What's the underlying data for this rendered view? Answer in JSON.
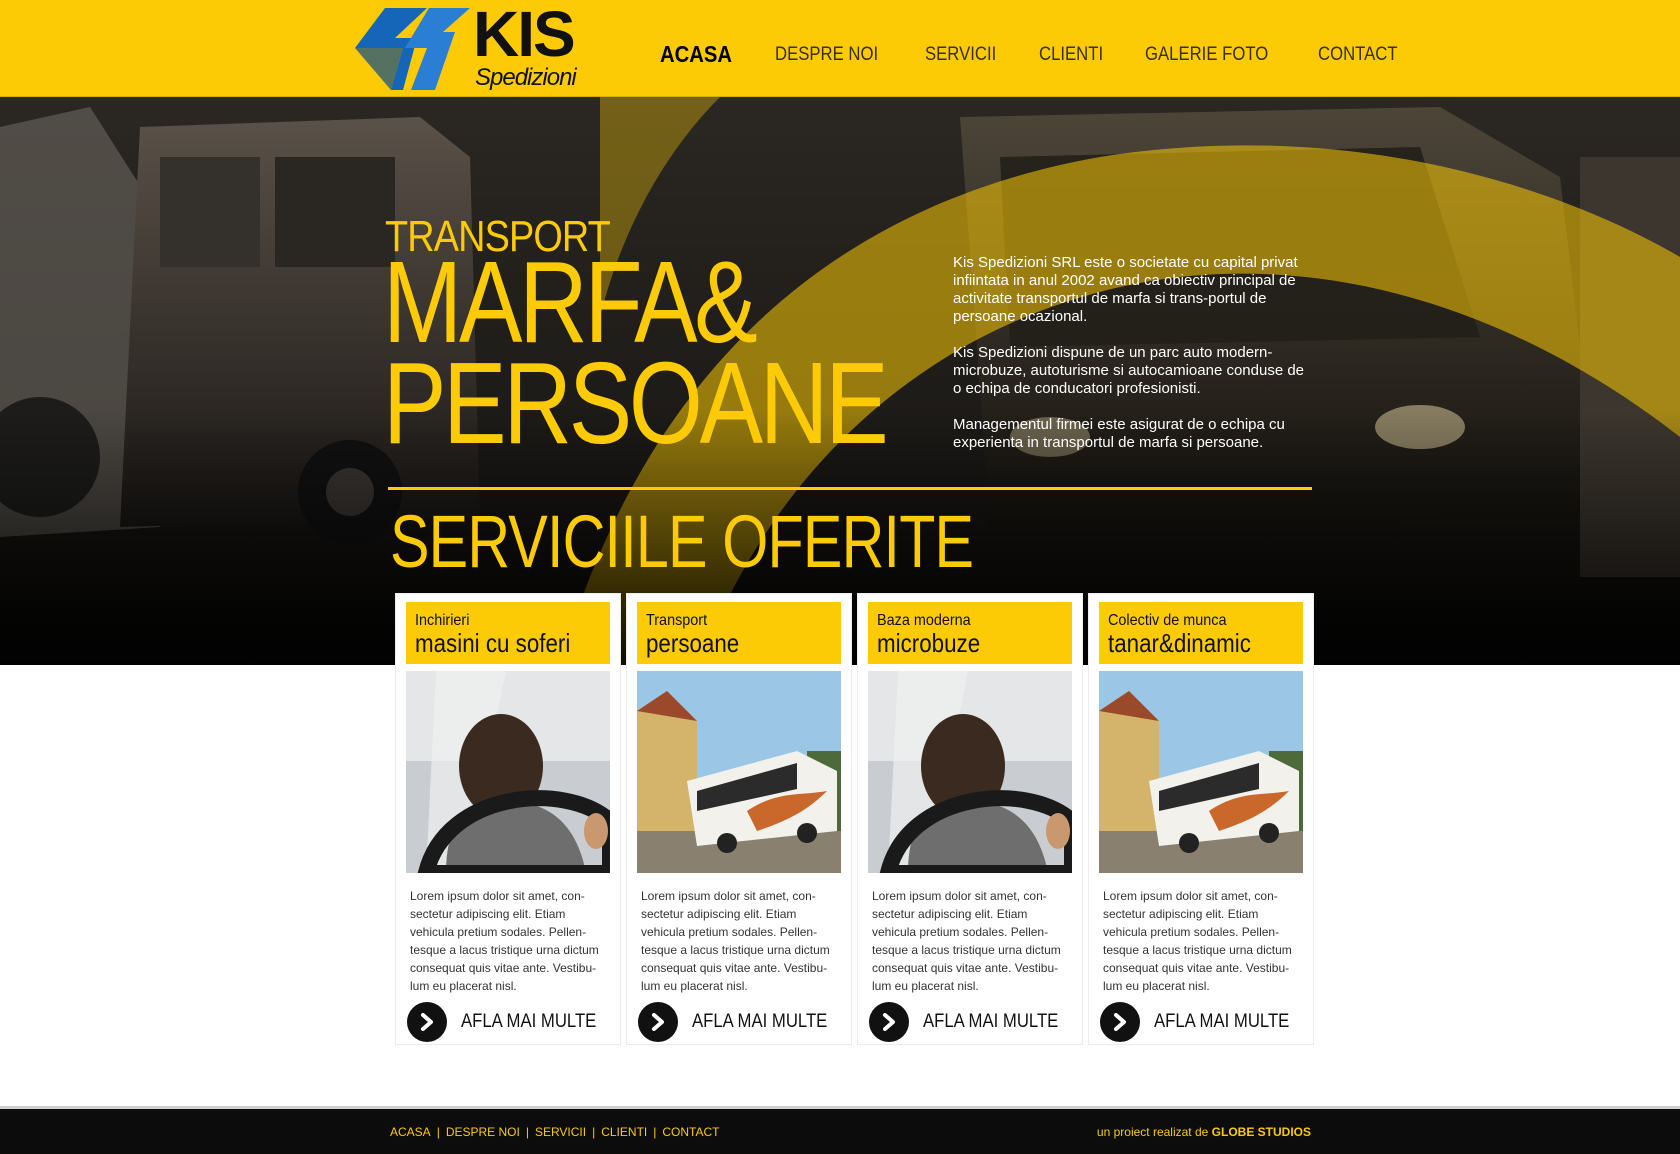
{
  "brand": {
    "name": "KIS",
    "sub": "Spedizioni",
    "accent": "#fccb06",
    "mark_color": "#1565b8"
  },
  "nav": {
    "items": [
      "ACASA",
      "DESPRE NOI",
      "SERVICII",
      "CLIENTI",
      "GALERIE FOTO",
      "CONTACT"
    ],
    "active": "ACASA"
  },
  "hero": {
    "line1": "TRANSPORT",
    "line2": "MARFA&",
    "line3": "PERSOANE",
    "paragraphs": [
      "Kis Spedizioni SRL este o societate cu capital privat infiintata in anul 2002 avand ca obiectiv principal de activitate transportul de marfa si trans-portul de persoane ocazional.",
      "Kis Spedizioni dispune de un parc auto modern-microbuze, autoturisme si autocamioane conduse de o echipa de conducatori profesionisti.",
      "Managementul firmei este asigurat de o echipa cu experienta in transportul de marfa si persoane."
    ],
    "services_heading": "SERVICIILE OFERITE"
  },
  "cards": [
    {
      "t1": "Inchirieri",
      "t2": "masini cu soferi",
      "photo": "driver-icon",
      "text": "Lorem ipsum dolor sit amet, con-sectetur adipiscing elit. Etiam vehicula pretium sodales. Pellen-tesque a lacus tristique urna dictum consequat quis vitae ante. Vestibu-lum eu placerat nisl.",
      "more": "AFLA MAI MULTE"
    },
    {
      "t1": "Transport",
      "t2": "persoane",
      "photo": "bus-icon",
      "text": "Lorem ipsum dolor sit amet, con-sectetur adipiscing elit. Etiam vehicula pretium sodales. Pellen-tesque a lacus tristique urna dictum consequat quis vitae ante. Vestibu-lum eu placerat nisl.",
      "more": "AFLA MAI MULTE"
    },
    {
      "t1": "Baza moderna",
      "t2": "microbuze",
      "photo": "driver-icon",
      "text": "Lorem ipsum dolor sit amet, con-sectetur adipiscing elit. Etiam vehicula pretium sodales. Pellen-tesque a lacus tristique urna dictum consequat quis vitae ante. Vestibu-lum eu placerat nisl.",
      "more": "AFLA MAI MULTE"
    },
    {
      "t1": "Colectiv de munca",
      "t2": "tanar&dinamic",
      "photo": "bus-icon",
      "text": "Lorem ipsum dolor sit amet, con-sectetur adipiscing elit. Etiam vehicula pretium sodales. Pellen-tesque a lacus tristique urna dictum consequat quis vitae ante. Vestibu-lum eu placerat nisl.",
      "more": "AFLA MAI MULTE"
    }
  ],
  "footer": {
    "links": [
      "ACASA",
      "DESPRE NOI",
      "SERVICII",
      "CLIENTI",
      "CONTACT"
    ],
    "separator": "|",
    "credit_prefix": "un proiect realizat de",
    "credit_name": "GLOBE STUDIOS"
  }
}
